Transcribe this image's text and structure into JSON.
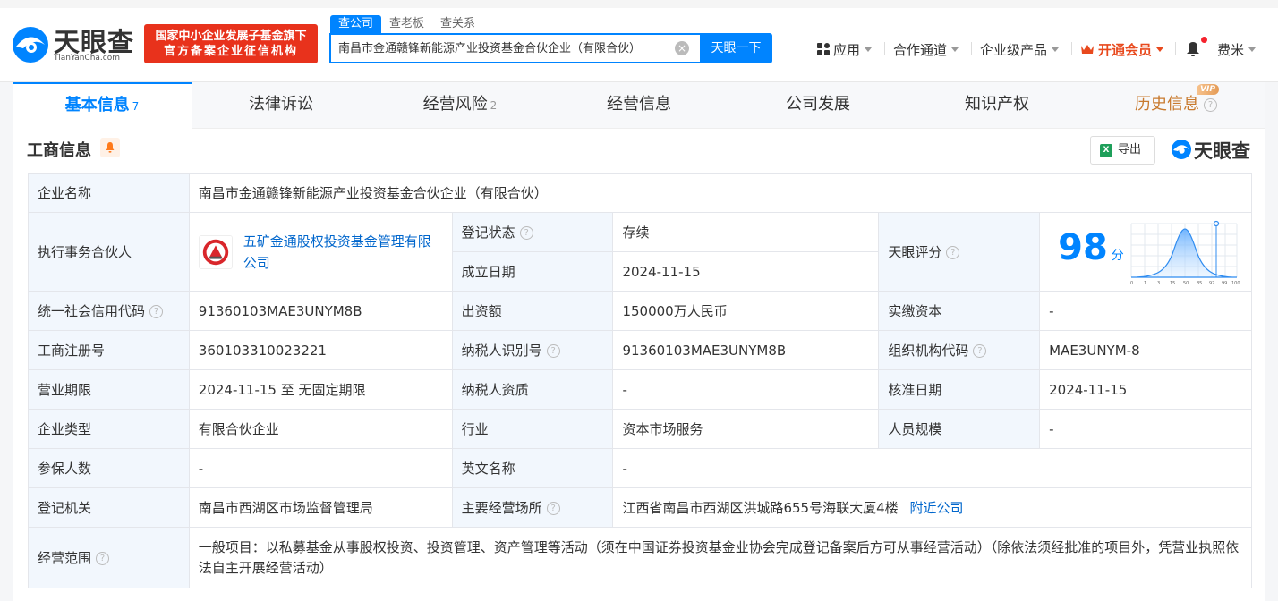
{
  "header": {
    "logo_text": "天眼查",
    "logo_sub": "TianYanCha.com",
    "badge_line1": "国家中小企业发展子基金旗下",
    "badge_line2": "官方备案企业征信机构",
    "search_tabs": [
      "查公司",
      "查老板",
      "查关系"
    ],
    "search_value": "南昌市金通赣锋新能源产业投资基金合伙企业（有限合伙）",
    "search_button": "天眼一下",
    "nav": {
      "app": "应用",
      "channel": "合作通道",
      "enterprise": "企业级产品",
      "vip": "开通会员",
      "user": "费米"
    }
  },
  "tabs": [
    {
      "label": "基本信息",
      "count": "7"
    },
    {
      "label": "法律诉讼",
      "count": ""
    },
    {
      "label": "经营风险",
      "count": "2"
    },
    {
      "label": "经营信息",
      "count": ""
    },
    {
      "label": "公司发展",
      "count": ""
    },
    {
      "label": "知识产权",
      "count": ""
    },
    {
      "label": "历史信息",
      "count": "",
      "badge": "VIP"
    }
  ],
  "section": {
    "title": "工商信息",
    "export": "导出",
    "brand": "天眼查"
  },
  "info": {
    "company_name_label": "企业名称",
    "company_name": "南昌市金通赣锋新能源产业投资基金合伙企业（有限合伙）",
    "partner_label": "执行事务合伙人",
    "partner": "五矿金通股权投资基金管理有限公司",
    "reg_status_label": "登记状态",
    "reg_status": "存续",
    "found_date_label": "成立日期",
    "found_date": "2024-11-15",
    "score_label": "天眼评分",
    "score": "98",
    "score_unit": "分",
    "score_axis": [
      "0",
      "1",
      "3",
      "15",
      "50",
      "85",
      "97",
      "99",
      "100"
    ],
    "credit_code_label": "统一社会信用代码",
    "credit_code": "91360103MAE3UNYM8B",
    "capital_label": "出资额",
    "capital": "150000万人民币",
    "paid_capital_label": "实缴资本",
    "paid_capital": "-",
    "reg_no_label": "工商注册号",
    "reg_no": "360103310023221",
    "taxpayer_id_label": "纳税人识别号",
    "taxpayer_id": "91360103MAE3UNYM8B",
    "org_code_label": "组织机构代码",
    "org_code": "MAE3UNYM-8",
    "term_label": "营业期限",
    "term": "2024-11-15 至 无固定期限",
    "taxpayer_qual_label": "纳税人资质",
    "taxpayer_qual": "-",
    "approve_date_label": "核准日期",
    "approve_date": "2024-11-15",
    "type_label": "企业类型",
    "type": "有限合伙企业",
    "industry_label": "行业",
    "industry": "资本市场服务",
    "staff_label": "人员规模",
    "staff": "-",
    "insured_label": "参保人数",
    "insured": "-",
    "english_name_label": "英文名称",
    "english_name": "-",
    "authority_label": "登记机关",
    "authority": "南昌市西湖区市场监督管理局",
    "address_label": "主要经营场所",
    "address": "江西省南昌市西湖区洪城路655号海联大厦4楼",
    "nearby": "附近公司",
    "scope_label": "经营范围",
    "scope": "一般项目：以私募基金从事股权投资、投资管理、资产管理等活动（须在中国证券投资基金业协会完成登记备案后方可从事经营活动）（除依法须经批准的项目外，凭营业执照依法自主开展经营活动）"
  },
  "colors": {
    "brand_blue": "#0084ff",
    "badge_red": "#e8321c",
    "status_green": "#12a84a",
    "vip_orange": "#e8491d"
  }
}
